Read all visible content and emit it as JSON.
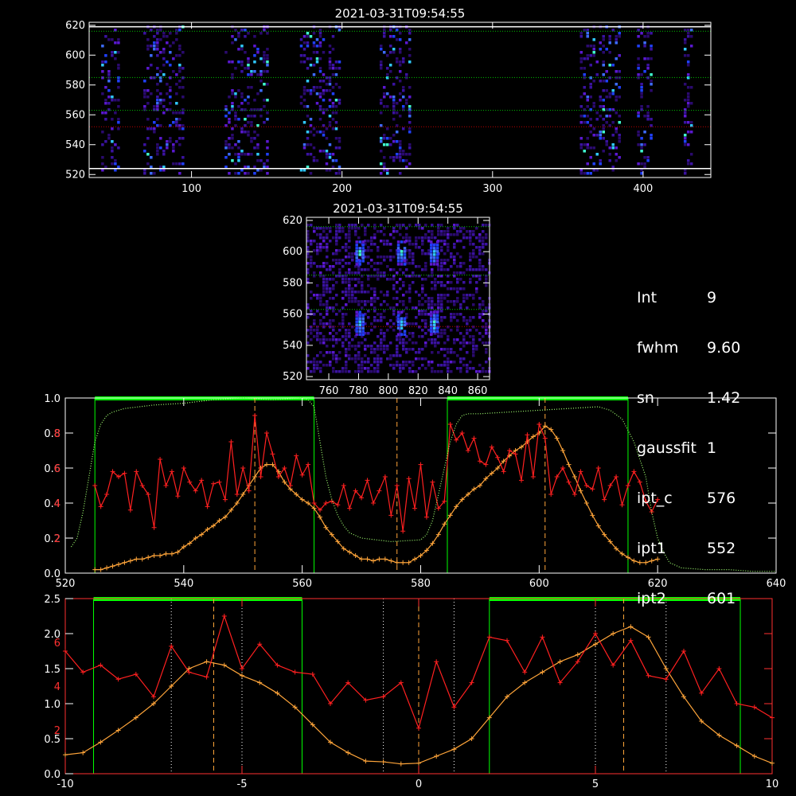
{
  "colors": {
    "intensity_curve": "#ff2020",
    "profile_curve": "#ffa53a",
    "sensitivity_curve": "#a0ff70",
    "window_bar": "#00ff00",
    "window_edge": "#00ff00",
    "axes_red": "#ff3030",
    "axes_white": "#ffffff",
    "guide_green": "#00c000",
    "guide_red": "#c00000"
  },
  "info": {
    "rows": [
      {
        "key": "Int",
        "value": "9"
      },
      {
        "key": "fwhm",
        "value": "9.60"
      },
      {
        "key": "sn",
        "value": "1.42"
      },
      {
        "key": "gaussfit",
        "value": "1"
      },
      {
        "key": "ipt_c",
        "value": "576"
      },
      {
        "key": "ipt1",
        "value": "552"
      },
      {
        "key": "ipt2",
        "value": "601"
      }
    ]
  },
  "chart_data": [
    {
      "type": "heatmap",
      "title": "2021-03-31T09:54:55",
      "xlim": [
        32,
        445
      ],
      "ylim": [
        518,
        622
      ],
      "xticks": [
        100,
        200,
        300,
        400
      ],
      "yticks": [
        520,
        540,
        560,
        580,
        600,
        620
      ],
      "column_bands": [
        [
          40,
          52
        ],
        [
          68,
          95
        ],
        [
          122,
          150
        ],
        [
          172,
          198
        ],
        [
          225,
          245
        ],
        [
          358,
          384
        ],
        [
          396,
          406
        ],
        [
          427,
          432
        ]
      ],
      "hlines_green": [
        616,
        585,
        563
      ],
      "hlines_red": [
        552
      ],
      "hlines_white": [
        619,
        524
      ]
    },
    {
      "type": "heatmap",
      "title": "2021-03-31T09:54:55",
      "xlim": [
        745,
        868
      ],
      "ylim": [
        518,
        622
      ],
      "xticks": [
        760,
        780,
        800,
        820,
        840,
        860
      ],
      "yticks": [
        520,
        540,
        560,
        580,
        600,
        620
      ],
      "blobs": [
        [
          780,
          600
        ],
        [
          808,
          600
        ],
        [
          830,
          600
        ],
        [
          780,
          555
        ],
        [
          808,
          555
        ],
        [
          830,
          555
        ]
      ],
      "hlines_green": [
        616,
        585,
        563
      ],
      "hlines_red": [
        552
      ]
    },
    {
      "type": "line",
      "xlim": [
        520,
        640
      ],
      "xticks": [
        520,
        540,
        560,
        580,
        600,
        620,
        640
      ],
      "ylim_left_white": [
        0,
        1.0
      ],
      "yticks_left_white": [
        "0.0",
        "0.2",
        "0.4",
        "0.6",
        "0.8",
        "1.0"
      ],
      "yticks_left_red": [
        "2",
        "4",
        "6",
        "8"
      ],
      "windows": [
        [
          525,
          562
        ],
        [
          584.5,
          615
        ]
      ],
      "vlines": [
        552,
        576,
        601
      ],
      "series": [
        {
          "x": [
            525,
            526,
            527,
            528,
            529,
            530,
            531,
            532,
            533,
            534,
            535,
            536,
            537,
            538,
            539,
            540,
            541,
            542,
            543,
            544,
            545,
            546,
            547,
            548,
            549,
            550,
            551,
            552,
            553,
            554,
            555,
            556,
            557,
            558,
            559,
            560,
            561,
            562,
            563,
            564,
            565,
            566,
            567,
            568,
            569,
            570,
            571,
            572,
            573,
            574,
            575,
            576,
            577,
            578,
            579,
            580,
            581,
            582,
            583,
            584,
            585,
            586,
            587,
            588,
            589,
            590,
            591,
            592,
            593,
            594,
            595,
            596,
            597,
            598,
            599,
            600,
            601,
            602,
            603,
            604,
            605,
            606,
            607,
            608,
            609,
            610,
            611,
            612,
            613,
            614,
            615,
            616,
            617,
            618,
            619,
            620
          ],
          "values": [
            0.02,
            0.02,
            0.03,
            0.04,
            0.05,
            0.06,
            0.07,
            0.08,
            0.08,
            0.09,
            0.1,
            0.1,
            0.11,
            0.11,
            0.12,
            0.15,
            0.17,
            0.2,
            0.22,
            0.25,
            0.27,
            0.3,
            0.32,
            0.36,
            0.4,
            0.45,
            0.5,
            0.55,
            0.6,
            0.62,
            0.62,
            0.58,
            0.52,
            0.48,
            0.45,
            0.42,
            0.4,
            0.37,
            0.32,
            0.26,
            0.22,
            0.18,
            0.14,
            0.12,
            0.1,
            0.08,
            0.08,
            0.07,
            0.08,
            0.08,
            0.07,
            0.06,
            0.06,
            0.06,
            0.08,
            0.1,
            0.13,
            0.17,
            0.22,
            0.28,
            0.33,
            0.38,
            0.42,
            0.45,
            0.48,
            0.5,
            0.54,
            0.57,
            0.6,
            0.64,
            0.67,
            0.7,
            0.72,
            0.75,
            0.78,
            0.8,
            0.84,
            0.82,
            0.77,
            0.7,
            0.62,
            0.55,
            0.47,
            0.4,
            0.33,
            0.27,
            0.22,
            0.18,
            0.14,
            0.11,
            0.09,
            0.07,
            0.06,
            0.06,
            0.07,
            0.08
          ]
        },
        {
          "x": [
            525,
            526,
            527,
            528,
            529,
            530,
            531,
            532,
            533,
            534,
            535,
            536,
            537,
            538,
            539,
            540,
            541,
            542,
            543,
            544,
            545,
            546,
            547,
            548,
            549,
            550,
            551,
            552,
            553,
            554,
            555,
            556,
            557,
            558,
            559,
            560,
            561,
            562,
            563,
            564,
            565,
            566,
            567,
            568,
            569,
            570,
            571,
            572,
            573,
            574,
            575,
            576,
            577,
            578,
            579,
            580,
            581,
            582,
            583,
            584,
            585,
            586,
            587,
            588,
            589,
            590,
            591,
            592,
            593,
            594,
            595,
            596,
            597,
            598,
            599,
            600,
            601,
            602,
            603,
            604,
            605,
            606,
            607,
            608,
            609,
            610,
            611,
            612,
            613,
            614,
            615,
            616,
            617,
            618,
            619,
            620
          ],
          "values": [
            0.5,
            0.38,
            0.45,
            0.58,
            0.55,
            0.57,
            0.36,
            0.58,
            0.5,
            0.45,
            0.26,
            0.65,
            0.5,
            0.58,
            0.44,
            0.6,
            0.52,
            0.47,
            0.53,
            0.38,
            0.51,
            0.52,
            0.42,
            0.75,
            0.45,
            0.6,
            0.47,
            0.9,
            0.55,
            0.8,
            0.68,
            0.55,
            0.6,
            0.5,
            0.67,
            0.56,
            0.62,
            0.4,
            0.36,
            0.4,
            0.41,
            0.39,
            0.5,
            0.37,
            0.47,
            0.43,
            0.53,
            0.4,
            0.47,
            0.55,
            0.33,
            0.5,
            0.24,
            0.54,
            0.37,
            0.62,
            0.32,
            0.52,
            0.37,
            0.41,
            0.85,
            0.76,
            0.8,
            0.7,
            0.77,
            0.64,
            0.62,
            0.72,
            0.66,
            0.58,
            0.7,
            0.68,
            0.53,
            0.79,
            0.55,
            0.85,
            0.77,
            0.45,
            0.55,
            0.6,
            0.52,
            0.45,
            0.58,
            0.5,
            0.48,
            0.6,
            0.42,
            0.5,
            0.55,
            0.39,
            0.5,
            0.58,
            0.52,
            0.41,
            0.35,
            0.42
          ]
        },
        {
          "x": [
            521,
            522,
            523,
            524,
            525,
            526,
            527,
            528,
            529,
            530,
            535,
            540,
            545,
            550,
            555,
            560,
            561,
            562,
            563,
            564,
            565,
            566,
            567,
            568,
            570,
            575,
            580,
            581,
            582,
            583,
            584,
            585,
            586,
            587,
            588,
            590,
            595,
            600,
            605,
            610,
            612,
            614,
            616,
            618,
            619,
            620,
            621,
            622,
            624,
            628,
            632,
            636,
            640
          ],
          "values": [
            0.15,
            0.2,
            0.35,
            0.55,
            0.75,
            0.85,
            0.9,
            0.92,
            0.93,
            0.94,
            0.96,
            0.97,
            0.99,
            1.0,
            0.99,
            1.0,
            0.99,
            0.95,
            0.75,
            0.55,
            0.42,
            0.33,
            0.27,
            0.23,
            0.2,
            0.18,
            0.19,
            0.22,
            0.3,
            0.45,
            0.6,
            0.75,
            0.85,
            0.9,
            0.91,
            0.91,
            0.92,
            0.93,
            0.94,
            0.95,
            0.93,
            0.88,
            0.75,
            0.55,
            0.35,
            0.2,
            0.12,
            0.06,
            0.03,
            0.02,
            0.02,
            0.01,
            0.01
          ]
        }
      ]
    },
    {
      "type": "line",
      "xlim": [
        -10,
        10
      ],
      "xticks": [
        -10,
        -5,
        0,
        5,
        10
      ],
      "yticks_left_white": [
        "0.0",
        "0.5",
        "1.0",
        "1.5",
        "2.0",
        "2.5"
      ],
      "yticks_left_red": [
        "2",
        "4",
        "6"
      ],
      "windows": [
        [
          -9.2,
          -3.3
        ],
        [
          2,
          9.1
        ]
      ],
      "vlines_dotted": [
        -7,
        -5,
        -1,
        1,
        5,
        7
      ],
      "vlines": [
        -5.8,
        0,
        5.8
      ],
      "series": [
        {
          "x": [
            -10,
            -9.5,
            -9,
            -8.5,
            -8,
            -7.5,
            -7,
            -6.5,
            -6,
            -5.5,
            -5,
            -4.5,
            -4,
            -3.5,
            -3,
            -2.5,
            -2,
            -1.5,
            -1,
            -0.5,
            0,
            0.5,
            1,
            1.5,
            2,
            2.5,
            3,
            3.5,
            4,
            4.5,
            5,
            5.5,
            6,
            6.5,
            7,
            7.5,
            8,
            8.5,
            9,
            9.5,
            10
          ],
          "values": [
            0.27,
            0.3,
            0.45,
            0.62,
            0.8,
            1.0,
            1.25,
            1.5,
            1.6,
            1.55,
            1.4,
            1.3,
            1.15,
            0.95,
            0.7,
            0.45,
            0.3,
            0.18,
            0.17,
            0.14,
            0.15,
            0.25,
            0.35,
            0.5,
            0.8,
            1.1,
            1.3,
            1.45,
            1.6,
            1.7,
            1.85,
            2.0,
            2.1,
            1.95,
            1.5,
            1.1,
            0.75,
            0.55,
            0.4,
            0.25,
            0.15
          ]
        },
        {
          "x": [
            -10,
            -9.5,
            -9,
            -8.5,
            -8,
            -7.5,
            -7,
            -6.5,
            -6,
            -5.5,
            -5,
            -4.5,
            -4,
            -3.5,
            -3,
            -2.5,
            -2,
            -1.5,
            -1,
            -0.5,
            0,
            0.5,
            1,
            1.5,
            2,
            2.5,
            3,
            3.5,
            4,
            4.5,
            5,
            5.5,
            6,
            6.5,
            7,
            7.5,
            8,
            8.5,
            9,
            9.5,
            10
          ],
          "values": [
            1.75,
            1.45,
            1.55,
            1.35,
            1.42,
            1.1,
            1.82,
            1.45,
            1.38,
            2.25,
            1.5,
            1.85,
            1.55,
            1.45,
            1.42,
            1.0,
            1.3,
            1.05,
            1.1,
            1.3,
            0.65,
            1.6,
            0.95,
            1.3,
            1.95,
            1.9,
            1.45,
            1.95,
            1.3,
            1.6,
            2.0,
            1.55,
            1.9,
            1.4,
            1.35,
            1.75,
            1.15,
            1.5,
            1.0,
            0.95,
            0.8
          ]
        }
      ]
    }
  ]
}
